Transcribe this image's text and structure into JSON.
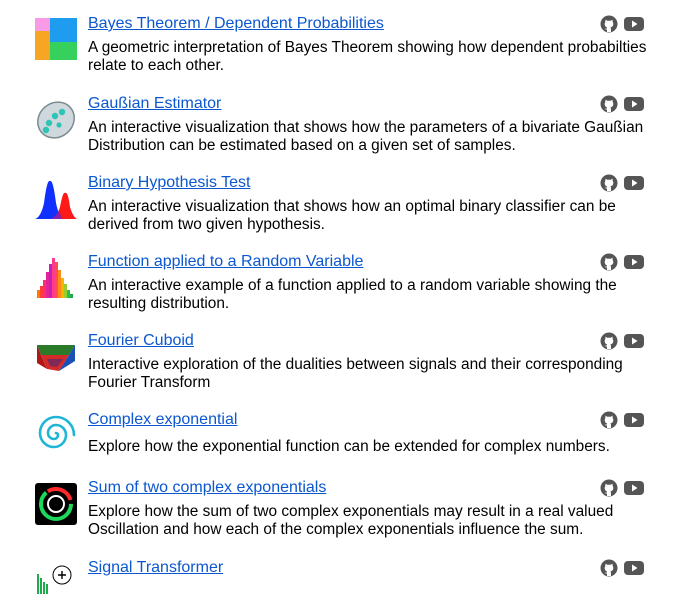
{
  "items": [
    {
      "title": "Bayes Theorem / Dependent Probabilities",
      "description": "A geometric interpretation of Bayes Theorem showing how dependent probabilties relate to each other.",
      "thumbnail_icon": "bayes-squares-icon"
    },
    {
      "title": "Gaußian Estimator",
      "description": "An interactive visualization that shows how the parameters of a bivariate Gaußian Distribution can be estimated based on a given set of samples.",
      "thumbnail_icon": "gaussian-ellipse-icon"
    },
    {
      "title": "Binary Hypothesis Test",
      "description": "An interactive visualization that shows how an optimal binary classifier can be derived from two given hypothesis.",
      "thumbnail_icon": "hypothesis-curves-icon"
    },
    {
      "title": "Function applied to a Random Variable",
      "description": "An interactive example of a function applied to a random variable showing the resulting distribution.",
      "thumbnail_icon": "histogram-icon"
    },
    {
      "title": "Fourier Cuboid",
      "description": "Interactive exploration of the dualities between signals and their corresponding Fourier Transform",
      "thumbnail_icon": "cuboid-icon"
    },
    {
      "title": "Complex exponential",
      "description": "Explore how the exponential function can be extended for complex numbers.",
      "thumbnail_icon": "spiral-icon"
    },
    {
      "title": "Sum of two complex exponentials",
      "description": "Explore how the sum of two complex exponentials may result in a real valued Oscillation and how each of the complex exponentials influence the sum.",
      "thumbnail_icon": "rings-icon"
    },
    {
      "title": "Signal Transformer",
      "description": "",
      "thumbnail_icon": "signal-transformer-icon"
    }
  ],
  "action_icons": [
    "github-icon",
    "youtube-icon"
  ],
  "colors": {
    "link": "#0b57d0",
    "icon": "#555555"
  }
}
